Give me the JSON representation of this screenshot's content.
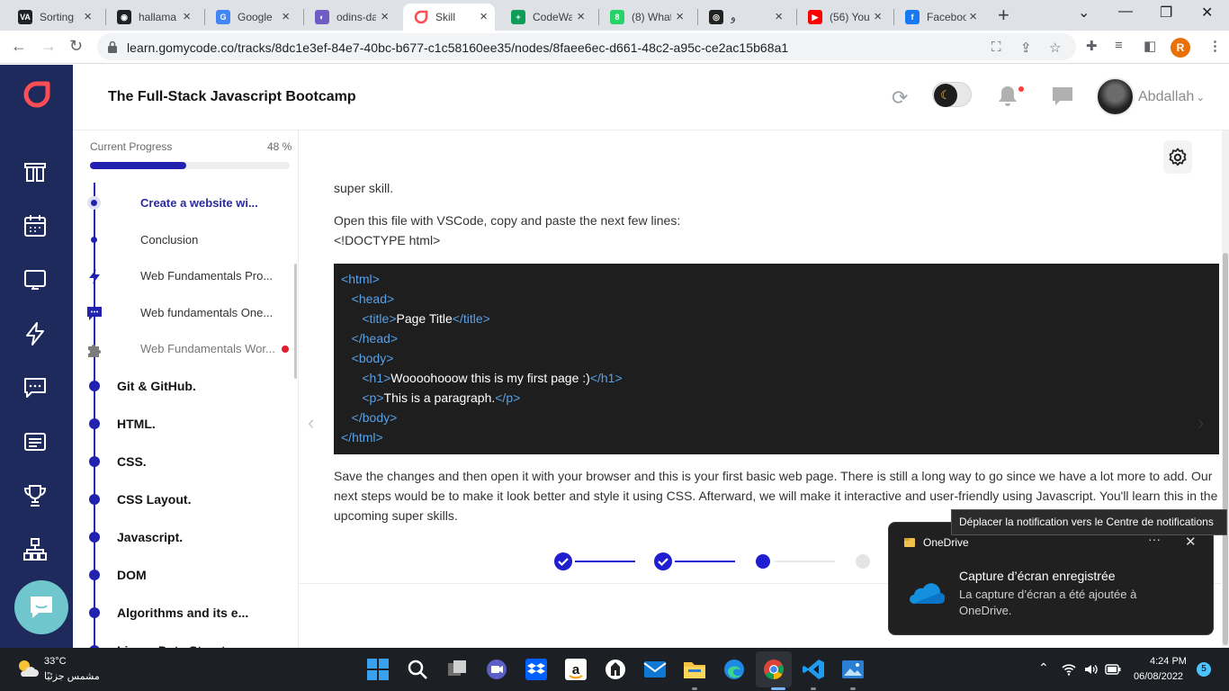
{
  "browser": {
    "tabs": [
      {
        "title": "Sorting",
        "icon": "va-icon",
        "color": "#202124",
        "glyph": "VA"
      },
      {
        "title": "hallama",
        "icon": "github-icon",
        "color": "#202124",
        "glyph": "◉"
      },
      {
        "title": "Google",
        "icon": "google-translate-icon",
        "color": "#4285f4",
        "glyph": "G"
      },
      {
        "title": "odins-da",
        "icon": "odin-icon",
        "color": "#6f5cc4",
        "glyph": "◐"
      },
      {
        "title": "Skill",
        "icon": "gomycode-icon",
        "color": "#ffffff",
        "glyph": ""
      },
      {
        "title": "CodeWa",
        "icon": "sheets-icon",
        "color": "#0f9d58",
        "glyph": "+"
      },
      {
        "title": "(8) What",
        "icon": "whatsapp-icon",
        "color": "#25d366",
        "glyph": "8"
      },
      {
        "title": "و",
        "icon": "audio-tab-icon",
        "color": "#222222",
        "glyph": "◎"
      },
      {
        "title": "(56) You",
        "icon": "youtube-icon",
        "color": "#ff0000",
        "glyph": "▶"
      },
      {
        "title": "Faceboo",
        "icon": "facebook-icon",
        "color": "#1877f2",
        "glyph": "f"
      }
    ],
    "active_tab_index": 4,
    "url": "learn.gomycode.co/tracks/8dc1e3ef-84e7-40bc-b677-c1c58160ee35/nodes/8faee6ec-d661-48c2-a95c-ce2ac15b68a1",
    "profile_initial": "R"
  },
  "app": {
    "course_title": "The Full-Stack Javascript Bootcamp",
    "username": "Abdallah",
    "accent_color": "#2222b0"
  },
  "sidebar": {
    "progress_label": "Current Progress",
    "progress_text": "48 %",
    "progress_value": 48,
    "sub_items": [
      {
        "label": "Create a website wi...",
        "state": "active",
        "kind": "dot"
      },
      {
        "label": "Conclusion",
        "state": "normal",
        "kind": "dot"
      },
      {
        "label": "Web Fundamentals Pro...",
        "state": "normal",
        "kind": "bolt-icon"
      },
      {
        "label": "Web fundamentals One...",
        "state": "normal",
        "kind": "chat-icon"
      },
      {
        "label": "Web Fundamentals Wor...",
        "state": "dim",
        "kind": "puzzle-icon",
        "alert": true
      }
    ],
    "sections": [
      "Git & GitHub.",
      "HTML.",
      "CSS.",
      "CSS Layout.",
      "Javascript.",
      "DOM",
      "Algorithms and its e...",
      "Linear Data Structur..."
    ]
  },
  "content": {
    "para_top": "super skill.",
    "para_open": "Open this file with VSCode, copy and paste the next few lines:",
    "para_doctype": "<!DOCTYPE html>",
    "code": [
      {
        "indent": "",
        "open": "<",
        "tag": "html",
        "close": ">",
        "text": "",
        "end": ""
      },
      {
        "indent": "   ",
        "open": "<",
        "tag": "head",
        "close": ">",
        "text": "",
        "end": ""
      },
      {
        "indent": "      ",
        "open": "<",
        "tag": "title",
        "close": ">",
        "text": "Page Title",
        "end": "</title>"
      },
      {
        "indent": "   ",
        "open": "</",
        "tag": "head",
        "close": ">",
        "text": "",
        "end": ""
      },
      {
        "indent": "   ",
        "open": "<",
        "tag": "body",
        "close": ">",
        "text": "",
        "end": ""
      },
      {
        "indent": "      ",
        "open": "<",
        "tag": "h1",
        "close": ">",
        "text": "Woooohooow this is my first page :)",
        "end": "</h1>"
      },
      {
        "indent": "      ",
        "open": "<",
        "tag": "p",
        "close": ">",
        "text": "This is a paragraph.",
        "end": "</p>"
      },
      {
        "indent": "   ",
        "open": "</",
        "tag": "body",
        "close": ">",
        "text": "",
        "end": ""
      },
      {
        "indent": "",
        "open": "</",
        "tag": "html",
        "close": ">",
        "text": "",
        "end": ""
      }
    ],
    "para_after": "Save the changes and then open it with your browser and this is your first basic web page. There is still a long way to go since we have a lot more to add. Our next steps would be to make it look better and style it using CSS. Afterward, we will make it interactive and user-friendly using Javascript. You'll learn this in the upcoming super skills.",
    "steps": [
      "done",
      "done",
      "current",
      "todo"
    ]
  },
  "notification": {
    "tooltip": "Déplacer la notification vers le Centre de notifications",
    "app_name": "OneDrive",
    "more": "···",
    "title": "Capture d’écran enregistrée",
    "body": "La capture d’écran a été ajoutée à OneDrive."
  },
  "taskbar": {
    "temperature": "33°C",
    "weather": "مشمس جزئيًا",
    "time": "4:24 PM",
    "date": "06/08/2022",
    "notification_count": "5"
  }
}
